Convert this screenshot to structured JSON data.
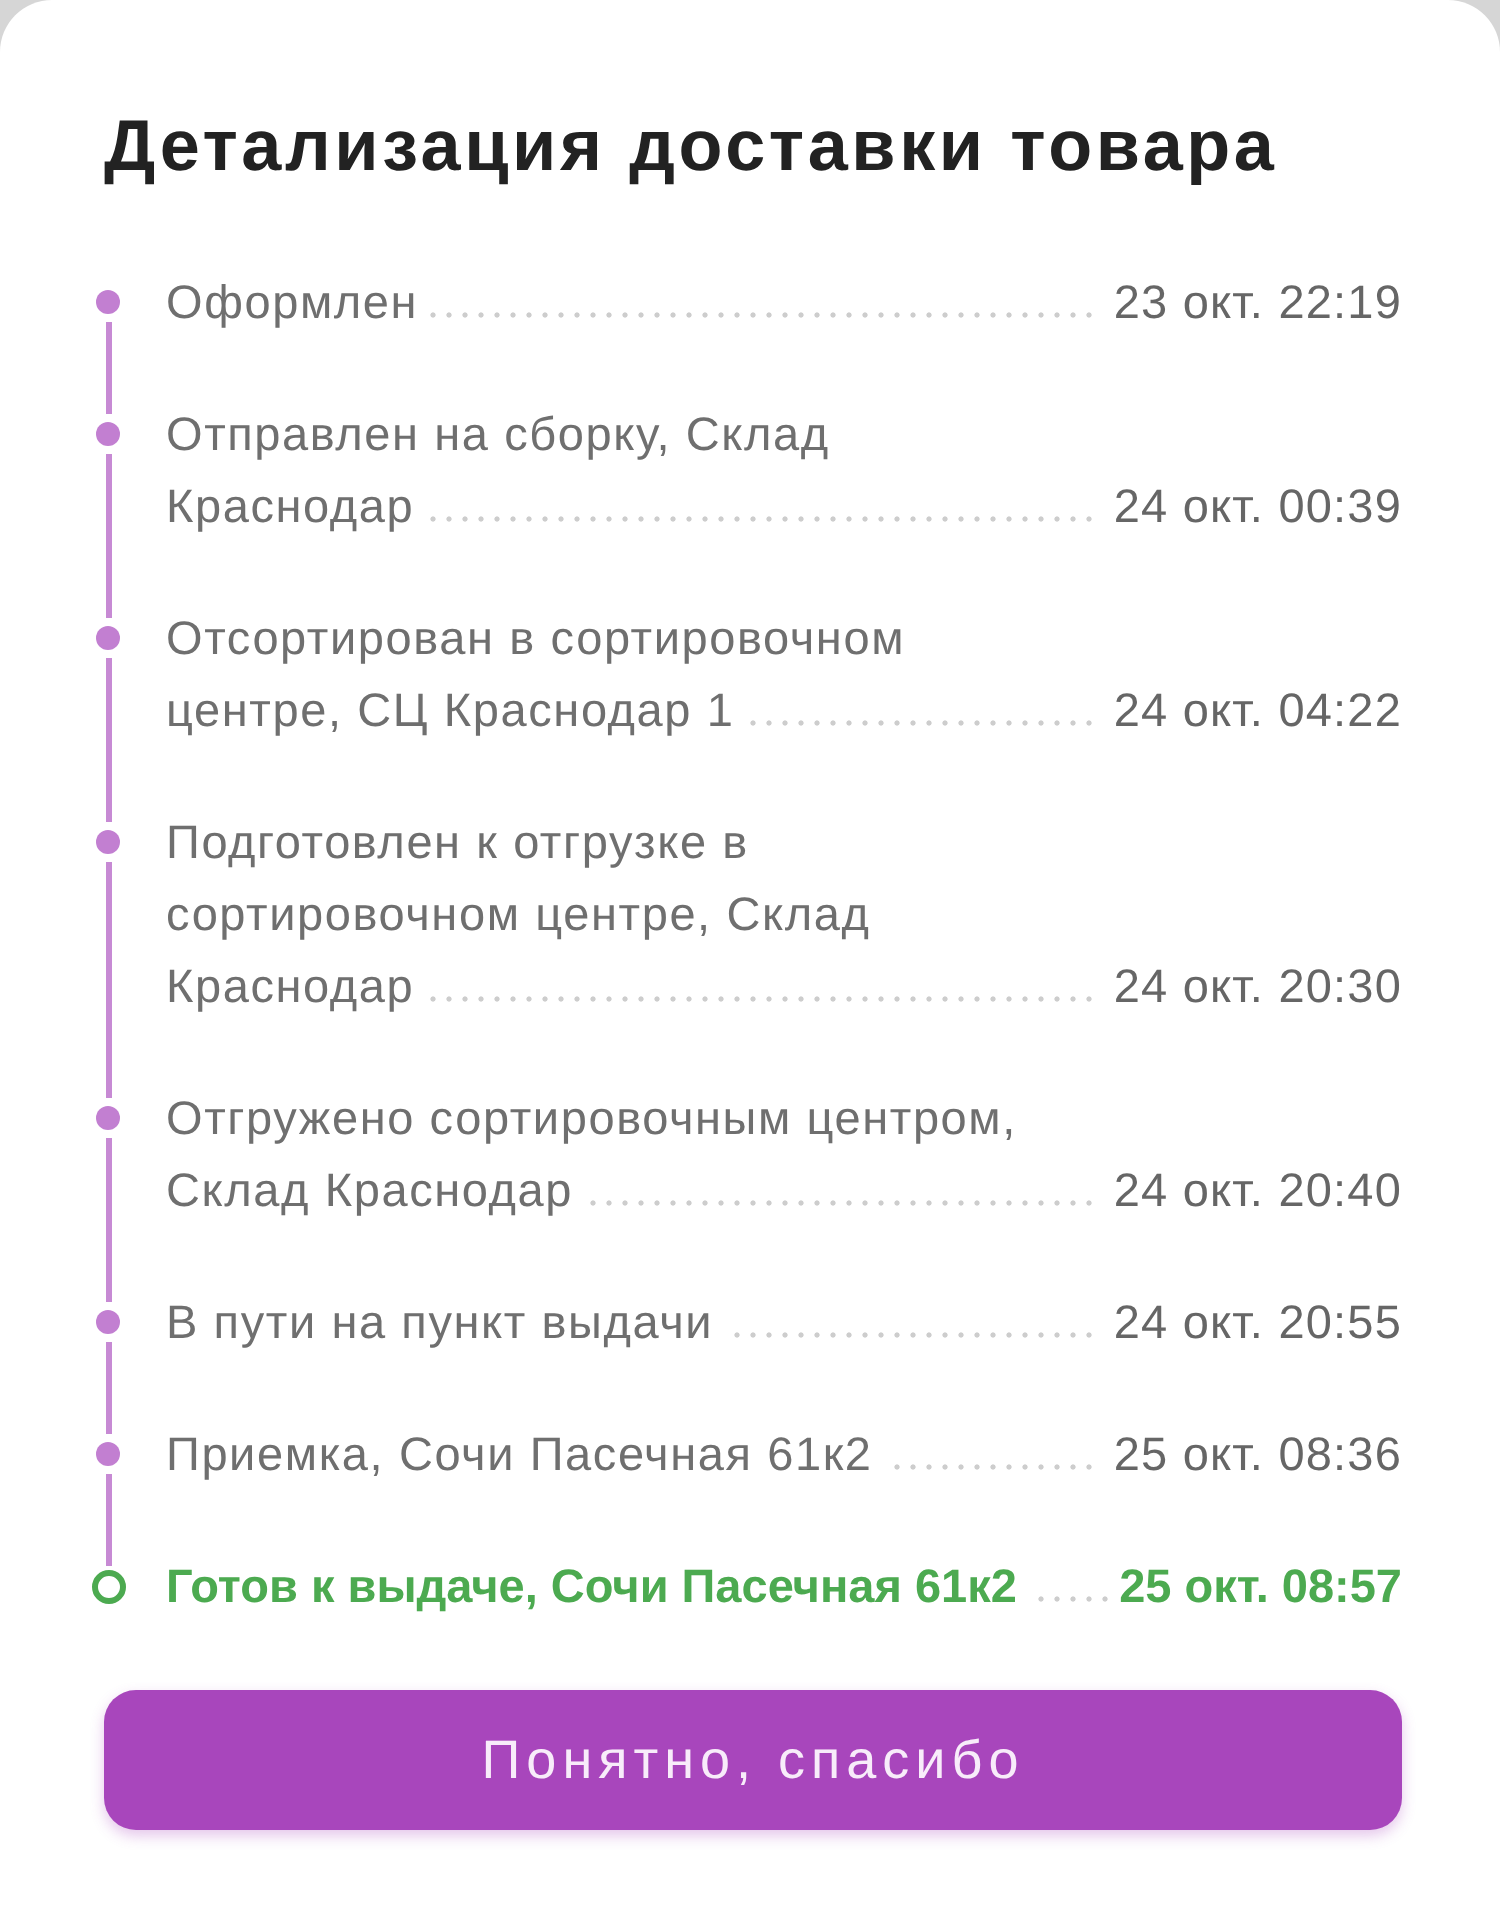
{
  "title": "Детализация доставки товара",
  "events": [
    {
      "status": "Оформлен",
      "time": "23 окт. 22:19",
      "current": false
    },
    {
      "status": "Отправлен на сборку, Склад\nКраснодар",
      "time": "24 окт. 00:39",
      "current": false
    },
    {
      "status": "Отсортирован в сортировочном\nцентре, СЦ Краснодар 1",
      "time": "24 окт. 04:22",
      "current": false
    },
    {
      "status": "Подготовлен к отгрузке в\nсортировочном центре, Склад\nКраснодар",
      "time": "24 окт. 20:30",
      "current": false
    },
    {
      "status": "Отгружено сортировочным центром,\nСклад Краснодар",
      "time": "24 окт. 20:40",
      "current": false
    },
    {
      "status": "В пути на пункт выдачи",
      "time": "24 окт. 20:55",
      "current": false
    },
    {
      "status": "Приемка, Сочи Пасечная 61к2",
      "time": "25 окт. 08:36",
      "current": false
    },
    {
      "status": "Готов к выдаче, Сочи Пасечная 61к2",
      "time": "25 окт. 08:57",
      "current": true
    }
  ],
  "button": {
    "label": "Понятно, спасибо"
  }
}
